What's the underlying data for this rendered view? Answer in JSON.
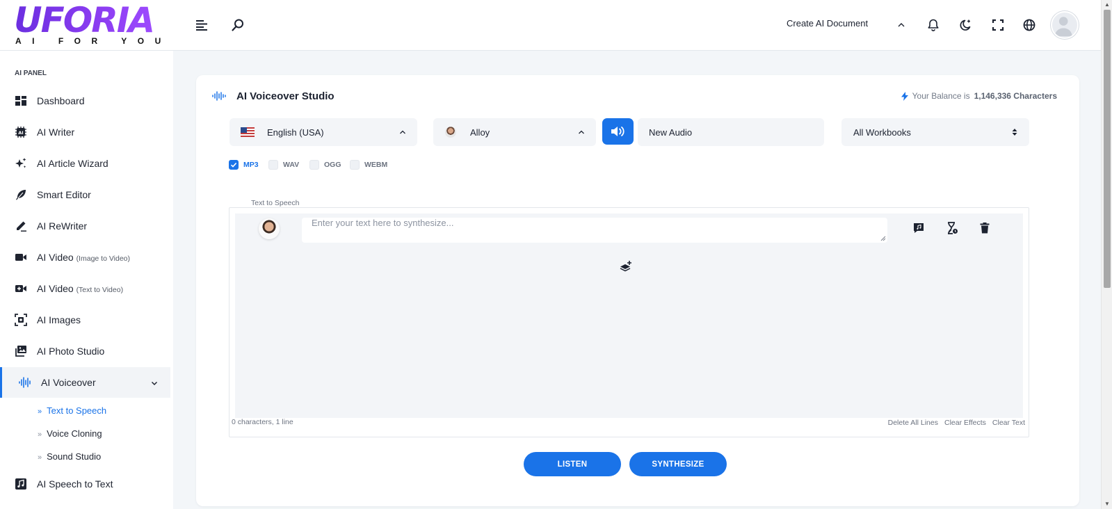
{
  "brand": {
    "logo_text": "UFORIA",
    "tagline": "AI FOR YOU"
  },
  "header": {
    "create_doc_label": "Create AI Document",
    "icons": [
      "menu-icon",
      "search-icon",
      "chevron-up-icon",
      "bell-icon",
      "moon-icon",
      "fullscreen-icon",
      "globe-icon",
      "user-avatar"
    ]
  },
  "sidebar": {
    "panel_title": "AI PANEL",
    "items": [
      {
        "label": "Dashboard",
        "sub": "",
        "icon": "dashboard-icon"
      },
      {
        "label": "AI Writer",
        "sub": "",
        "icon": "chip-icon"
      },
      {
        "label": "AI Article Wizard",
        "sub": "",
        "icon": "sparkles-icon"
      },
      {
        "label": "Smart Editor",
        "sub": "",
        "icon": "feather-icon"
      },
      {
        "label": "AI ReWriter",
        "sub": "",
        "icon": "pen-icon"
      },
      {
        "label": "AI Video",
        "sub": "(Image to Video)",
        "icon": "video-icon"
      },
      {
        "label": "AI Video",
        "sub": "(Text to Video)",
        "icon": "video-plus-icon"
      },
      {
        "label": "AI Images",
        "sub": "",
        "icon": "image-scan-icon"
      },
      {
        "label": "AI Photo Studio",
        "sub": "",
        "icon": "photos-icon"
      },
      {
        "label": "AI Voiceover",
        "sub": "",
        "icon": "waveform-icon"
      },
      {
        "label": "AI Speech to Text",
        "sub": "",
        "icon": "music-note-icon"
      }
    ],
    "voiceover_sub": [
      {
        "label": "Text to Speech",
        "active": true
      },
      {
        "label": "Voice Cloning",
        "active": false
      },
      {
        "label": "Sound Studio",
        "active": false
      }
    ]
  },
  "studio": {
    "title": "AI Voiceover Studio",
    "balance_prefix": "Your Balance is",
    "balance_value": "1,146,336 Characters",
    "language": "English (USA)",
    "voice": "Alloy",
    "audio_name": "New Audio",
    "workbook": "All Workbooks",
    "formats": [
      {
        "label": "MP3",
        "checked": true
      },
      {
        "label": "WAV",
        "checked": false
      },
      {
        "label": "OGG",
        "checked": false
      },
      {
        "label": "WEBM",
        "checked": false
      }
    ],
    "tts_legend": "Text to Speech",
    "text_placeholder": "Enter your text here to synthesize...",
    "counts": "0 characters, 1 line",
    "links": [
      "Delete All Lines",
      "Clear Effects",
      "Clear Text"
    ],
    "listen_label": "LISTEN",
    "synthesize_label": "SYNTHESIZE"
  },
  "colors": {
    "accent": "#1a73e8",
    "brand_purple": "#7b34ea"
  }
}
